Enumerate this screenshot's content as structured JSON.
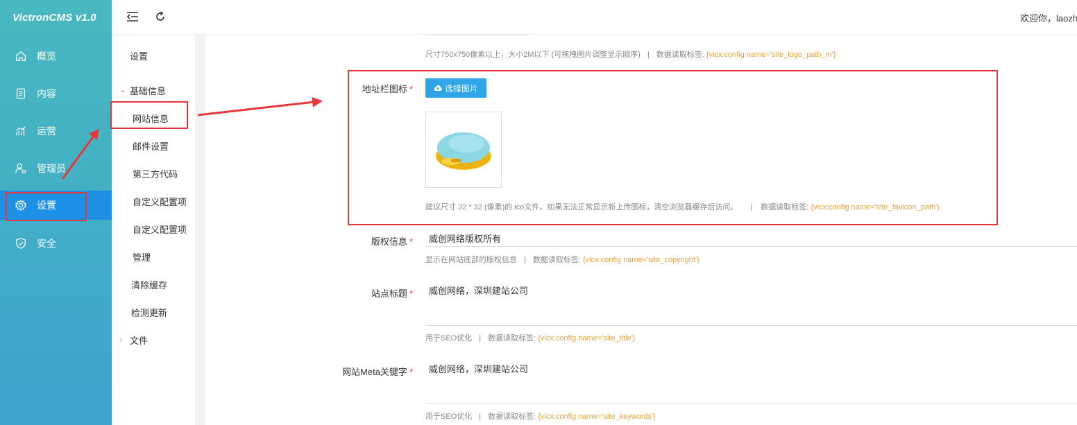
{
  "app": {
    "brand": "VictronCMS v1.0"
  },
  "topbar": {
    "welcome": "欢迎你，laozhang"
  },
  "sidebar": {
    "items": [
      {
        "label": "概览",
        "icon": "home-icon"
      },
      {
        "label": "内容",
        "icon": "document-icon"
      },
      {
        "label": "运营",
        "icon": "chart-icon"
      },
      {
        "label": "管理员",
        "icon": "admin-user-icon"
      },
      {
        "label": "设置",
        "icon": "gear-icon",
        "active": true
      },
      {
        "label": "安全",
        "icon": "shield-icon"
      }
    ]
  },
  "submenu": {
    "title": "设置",
    "group1": "基础信息",
    "leaves": [
      "网站信息",
      "邮件设置",
      "第三方代码",
      "自定义配置项",
      "自定义配置项",
      "管理",
      "清除缓存",
      "检测更新"
    ],
    "group2": "文件"
  },
  "form": {
    "logo_hint": "尺寸750x750像素以上，大小2M以下 (可拖拽图片调整显示顺序)",
    "logo_hint_label": "数据读取标签:",
    "logo_tag": "{vicx:config name='site_logo_path_m'}",
    "favicon_label": "地址栏图标",
    "pick_button": "选择图片",
    "favicon_hint": "建议尺寸 32 * 32 (像素)的.ico文件。如果无法正常显示新上传图标，清空浏览器缓存后访问。",
    "favicon_hint_label": "数据读取标签:",
    "favicon_tag": "{vicx:config name='site_favicon_path'}",
    "copyright_label": "版权信息",
    "copyright_value": "威创网络版权所有",
    "copyright_hint": "显示在网站底部的版权信息",
    "copyright_hint_label": "数据读取标签:",
    "copyright_tag": "{vicx:config name='site_copyright'}",
    "title_label": "站点标题",
    "title_value": "威创网络，深圳建站公司",
    "title_hint": "用于SEO优化",
    "title_hint_label": "数据读取标签:",
    "title_tag": "{vicx:config name='site_title'}",
    "keywords_label": "网站Meta关键字",
    "keywords_value": "威创网络，深圳建站公司",
    "keywords_hint": "用于SEO优化",
    "keywords_hint_label": "数据读取标签:",
    "keywords_tag": "{vicx:config name='site_keywords'}",
    "required_mark": "*",
    "sep": "|"
  },
  "colors": {
    "accent": "#1e90e6",
    "button": "#2fa4e7",
    "tag": "#e8a23a",
    "annotation": "#e8373a"
  }
}
